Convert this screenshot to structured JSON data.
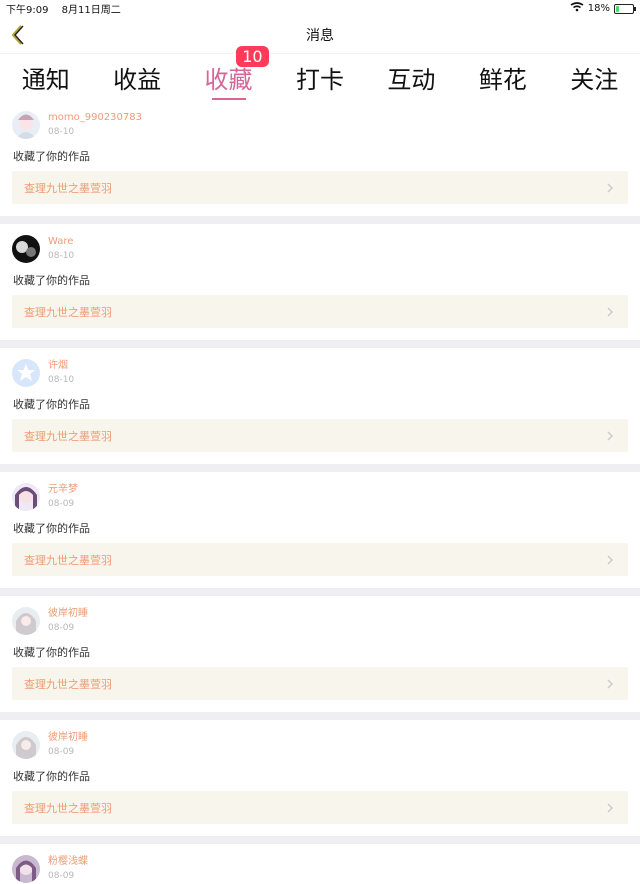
{
  "status": {
    "time": "下午9:09",
    "date": "8月11日周二",
    "battery": "18%"
  },
  "nav": {
    "title": "消息"
  },
  "tabs": [
    {
      "label": "通知"
    },
    {
      "label": "收益"
    },
    {
      "label": "收藏",
      "badge": "10"
    },
    {
      "label": "打卡"
    },
    {
      "label": "互动"
    },
    {
      "label": "鲜花"
    },
    {
      "label": "关注"
    }
  ],
  "messages": [
    {
      "name": "momo_990230783",
      "date": "08-10",
      "text": "收藏了你的作品",
      "work": "查理九世之墨萱羽"
    },
    {
      "name": "Ware",
      "date": "08-10",
      "text": "收藏了你的作品",
      "work": "查理九世之墨萱羽"
    },
    {
      "name": "许烟",
      "date": "08-10",
      "text": "收藏了你的作品",
      "work": "查理九世之墨萱羽"
    },
    {
      "name": "元辛梦",
      "date": "08-09",
      "text": "收藏了你的作品",
      "work": "查理九世之墨萱羽"
    },
    {
      "name": "彼岸初睡",
      "date": "08-09",
      "text": "收藏了你的作品",
      "work": "查理九世之墨萱羽"
    },
    {
      "name": "彼岸初睡",
      "date": "08-09",
      "text": "收藏了你的作品",
      "work": "查理九世之墨萱羽"
    },
    {
      "name": "粉樱浅蝶",
      "date": "08-09"
    }
  ]
}
